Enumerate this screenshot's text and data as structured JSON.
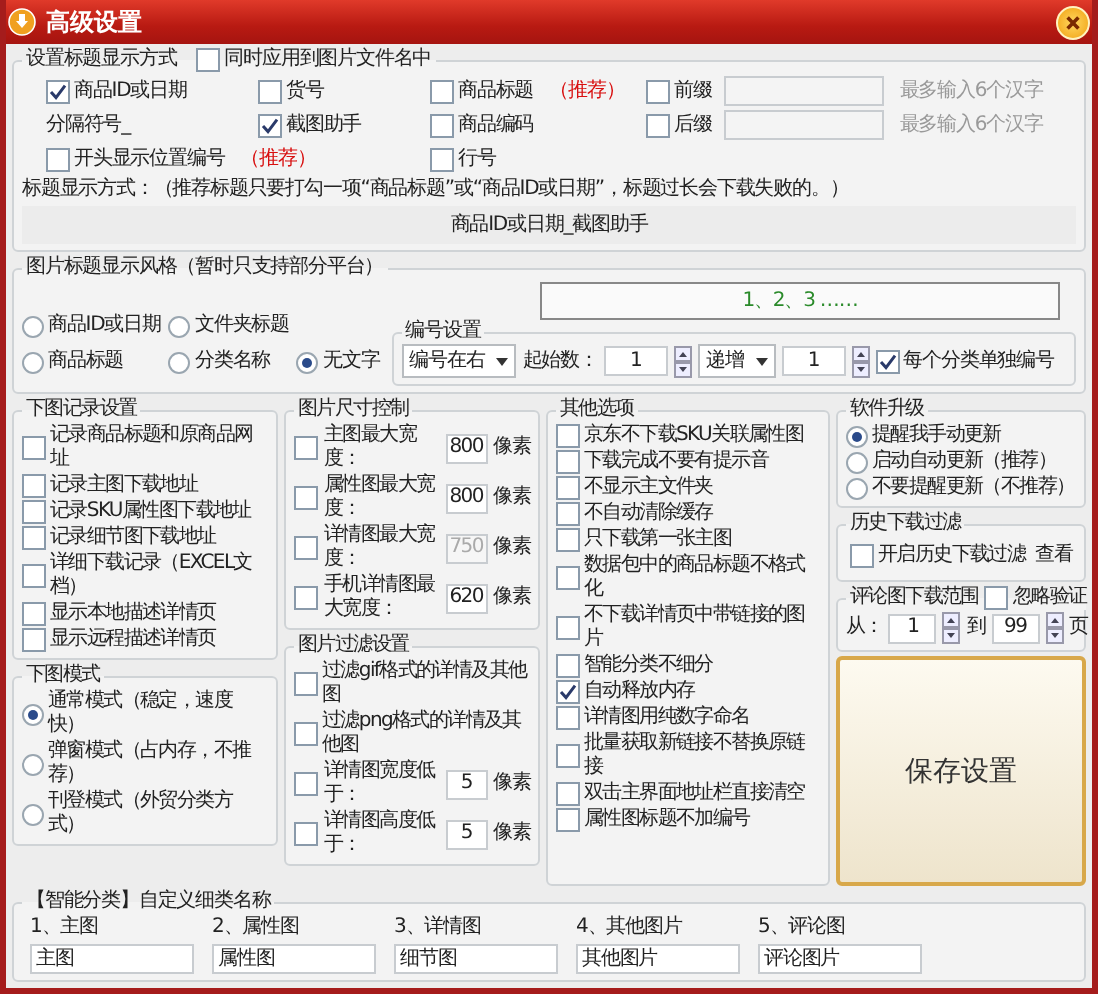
{
  "window": {
    "title": "高级设置"
  },
  "title_format": {
    "title": "设置标题显示方式",
    "apply_to_filename": {
      "label": "同时应用到图片文件名中",
      "checked": false
    },
    "rows": [
      [
        {
          "kind": "checkbox",
          "label": "商品ID或日期",
          "checked": true
        },
        {
          "kind": "checkbox",
          "label": "货号",
          "checked": false
        },
        {
          "kind": "checkbox",
          "label": "商品标题",
          "checked": false,
          "tag": "（推荐）"
        },
        {
          "kind": "affix",
          "label": "前缀",
          "checked": false,
          "hint": "最多输入6个汉字"
        }
      ],
      [
        {
          "kind": "text",
          "label": "分隔符号_"
        },
        {
          "kind": "checkbox",
          "label": "截图助手",
          "checked": true
        },
        {
          "kind": "checkbox",
          "label": "商品编码",
          "checked": false
        },
        {
          "kind": "affix",
          "label": "后缀",
          "checked": false,
          "hint": "最多输入6个汉字"
        }
      ],
      [
        {
          "kind": "checkbox",
          "label": "开头显示位置编号",
          "checked": false,
          "tag": "（推荐）"
        },
        "",
        {
          "kind": "checkbox",
          "label": "行号",
          "checked": false
        }
      ]
    ],
    "note": "标题显示方式：（推荐标题只要打勾一项“商品标题”或“商品ID或日期”，标题过长会下载失败的。）",
    "preview": "商品ID或日期_截图助手"
  },
  "caption_style": {
    "title": "图片标题显示风格（暂时只支持部分平台）",
    "options": [
      {
        "label": "商品ID或日期",
        "selected": false
      },
      {
        "label": "文件夹标题",
        "selected": false
      },
      {
        "label": "商品标题",
        "selected": false
      },
      {
        "label": "分类名称",
        "selected": false
      },
      {
        "label": "无文字",
        "selected": true
      }
    ],
    "numbering": {
      "title": "编号设置",
      "preview": "1、2、3 ……",
      "position": "编号在右",
      "start_label": "起始数：",
      "start": "1",
      "mode": "递增",
      "step": "1",
      "per_category": {
        "label": "每个分类单独编号",
        "checked": true
      }
    }
  },
  "download_log": {
    "title": "下图记录设置",
    "items": [
      {
        "label": "记录商品标题和原商品网址",
        "checked": false
      },
      {
        "label": "记录主图下载地址",
        "checked": false
      },
      {
        "label": "记录SKU属性图下载地址",
        "checked": false
      },
      {
        "label": "记录细节图下载地址",
        "checked": false
      },
      {
        "label": "详细下载记录（EXCEL文档）",
        "checked": false
      },
      {
        "label": "显示本地描述详情页",
        "checked": false
      },
      {
        "label": "显示远程描述详情页",
        "checked": false
      }
    ]
  },
  "download_mode": {
    "title": "下图模式",
    "options": [
      {
        "label": "通常模式（稳定，速度快）",
        "selected": true
      },
      {
        "label": "弹窗模式（占内存，不推荐）",
        "selected": false
      },
      {
        "label": "刊登模式（外贸分类方式）",
        "selected": false
      }
    ]
  },
  "size_control": {
    "title": "图片尺寸控制",
    "items": [
      {
        "label": "主图最大宽度：",
        "checked": false,
        "value": "800",
        "unit": "像素",
        "disabled": false
      },
      {
        "label": "属性图最大宽度：",
        "checked": false,
        "value": "800",
        "unit": "像素",
        "disabled": false
      },
      {
        "label": "详情图最大宽度：",
        "checked": false,
        "value": "750",
        "unit": "像素",
        "disabled": true
      },
      {
        "label": "手机详情图最大宽度：",
        "checked": false,
        "value": "620",
        "unit": "像素",
        "disabled": false
      }
    ]
  },
  "image_filter": {
    "title": "图片过滤设置",
    "items": [
      {
        "kind": "checkbox",
        "label": "过滤gif格式的详情及其他图",
        "checked": false
      },
      {
        "kind": "checkbox",
        "label": "过滤png格式的详情及其他图",
        "checked": false
      },
      {
        "kind": "threshold",
        "label": "详情图宽度低于：",
        "checked": false,
        "value": "5",
        "unit": "像素"
      },
      {
        "kind": "threshold",
        "label": "详情图高度低于：",
        "checked": false,
        "value": "5",
        "unit": "像素"
      }
    ]
  },
  "other_options": {
    "title": "其他选项",
    "items": [
      {
        "label": "京东不下载SKU关联属性图",
        "checked": false
      },
      {
        "label": "下载完成不要有提示音",
        "checked": false
      },
      {
        "label": "不显示主文件夹",
        "checked": false
      },
      {
        "label": "不自动清除缓存",
        "checked": false
      },
      {
        "label": "只下载第一张主图",
        "checked": false
      },
      {
        "label": "数据包中的商品标题不格式化",
        "checked": false
      },
      {
        "label": "不下载详情页中带链接的图片",
        "checked": false
      },
      {
        "label": "智能分类不细分",
        "checked": false
      },
      {
        "label": "自动释放内存",
        "checked": true
      },
      {
        "label": "详情图用纯数字命名",
        "checked": false
      },
      {
        "label": "批量获取新链接不替换原链接",
        "checked": false
      },
      {
        "label": "双击主界面地址栏直接清空",
        "checked": false
      },
      {
        "label": "属性图标题不加编号",
        "checked": false
      }
    ]
  },
  "upgrade": {
    "title": "软件升级",
    "options": [
      {
        "label": "提醒我手动更新",
        "selected": true
      },
      {
        "label": "启动自动更新（推荐）",
        "selected": false
      },
      {
        "label": "不要提醒更新（不推荐）",
        "selected": false
      }
    ]
  },
  "history_filter": {
    "title": "历史下载过滤",
    "toggle": {
      "label": "开启历史下载过滤",
      "checked": false
    },
    "link": "查看"
  },
  "review_range": {
    "title": "评论图下载范围",
    "ignore": {
      "label": "忽略验证",
      "checked": false
    },
    "from_label": "从：",
    "from": "1",
    "to_label": "到",
    "to": "99",
    "unit": "页"
  },
  "save_button": "保存设置",
  "custom_names": {
    "title": "【智能分类】自定义细类名称",
    "items": [
      {
        "label": "1、主图",
        "value": "主图"
      },
      {
        "label": "2、属性图",
        "value": "属性图"
      },
      {
        "label": "3、详情图",
        "value": "细节图"
      },
      {
        "label": "4、其他图片",
        "value": "其他图片"
      },
      {
        "label": "5、评论图",
        "value": "评论图片"
      }
    ]
  }
}
